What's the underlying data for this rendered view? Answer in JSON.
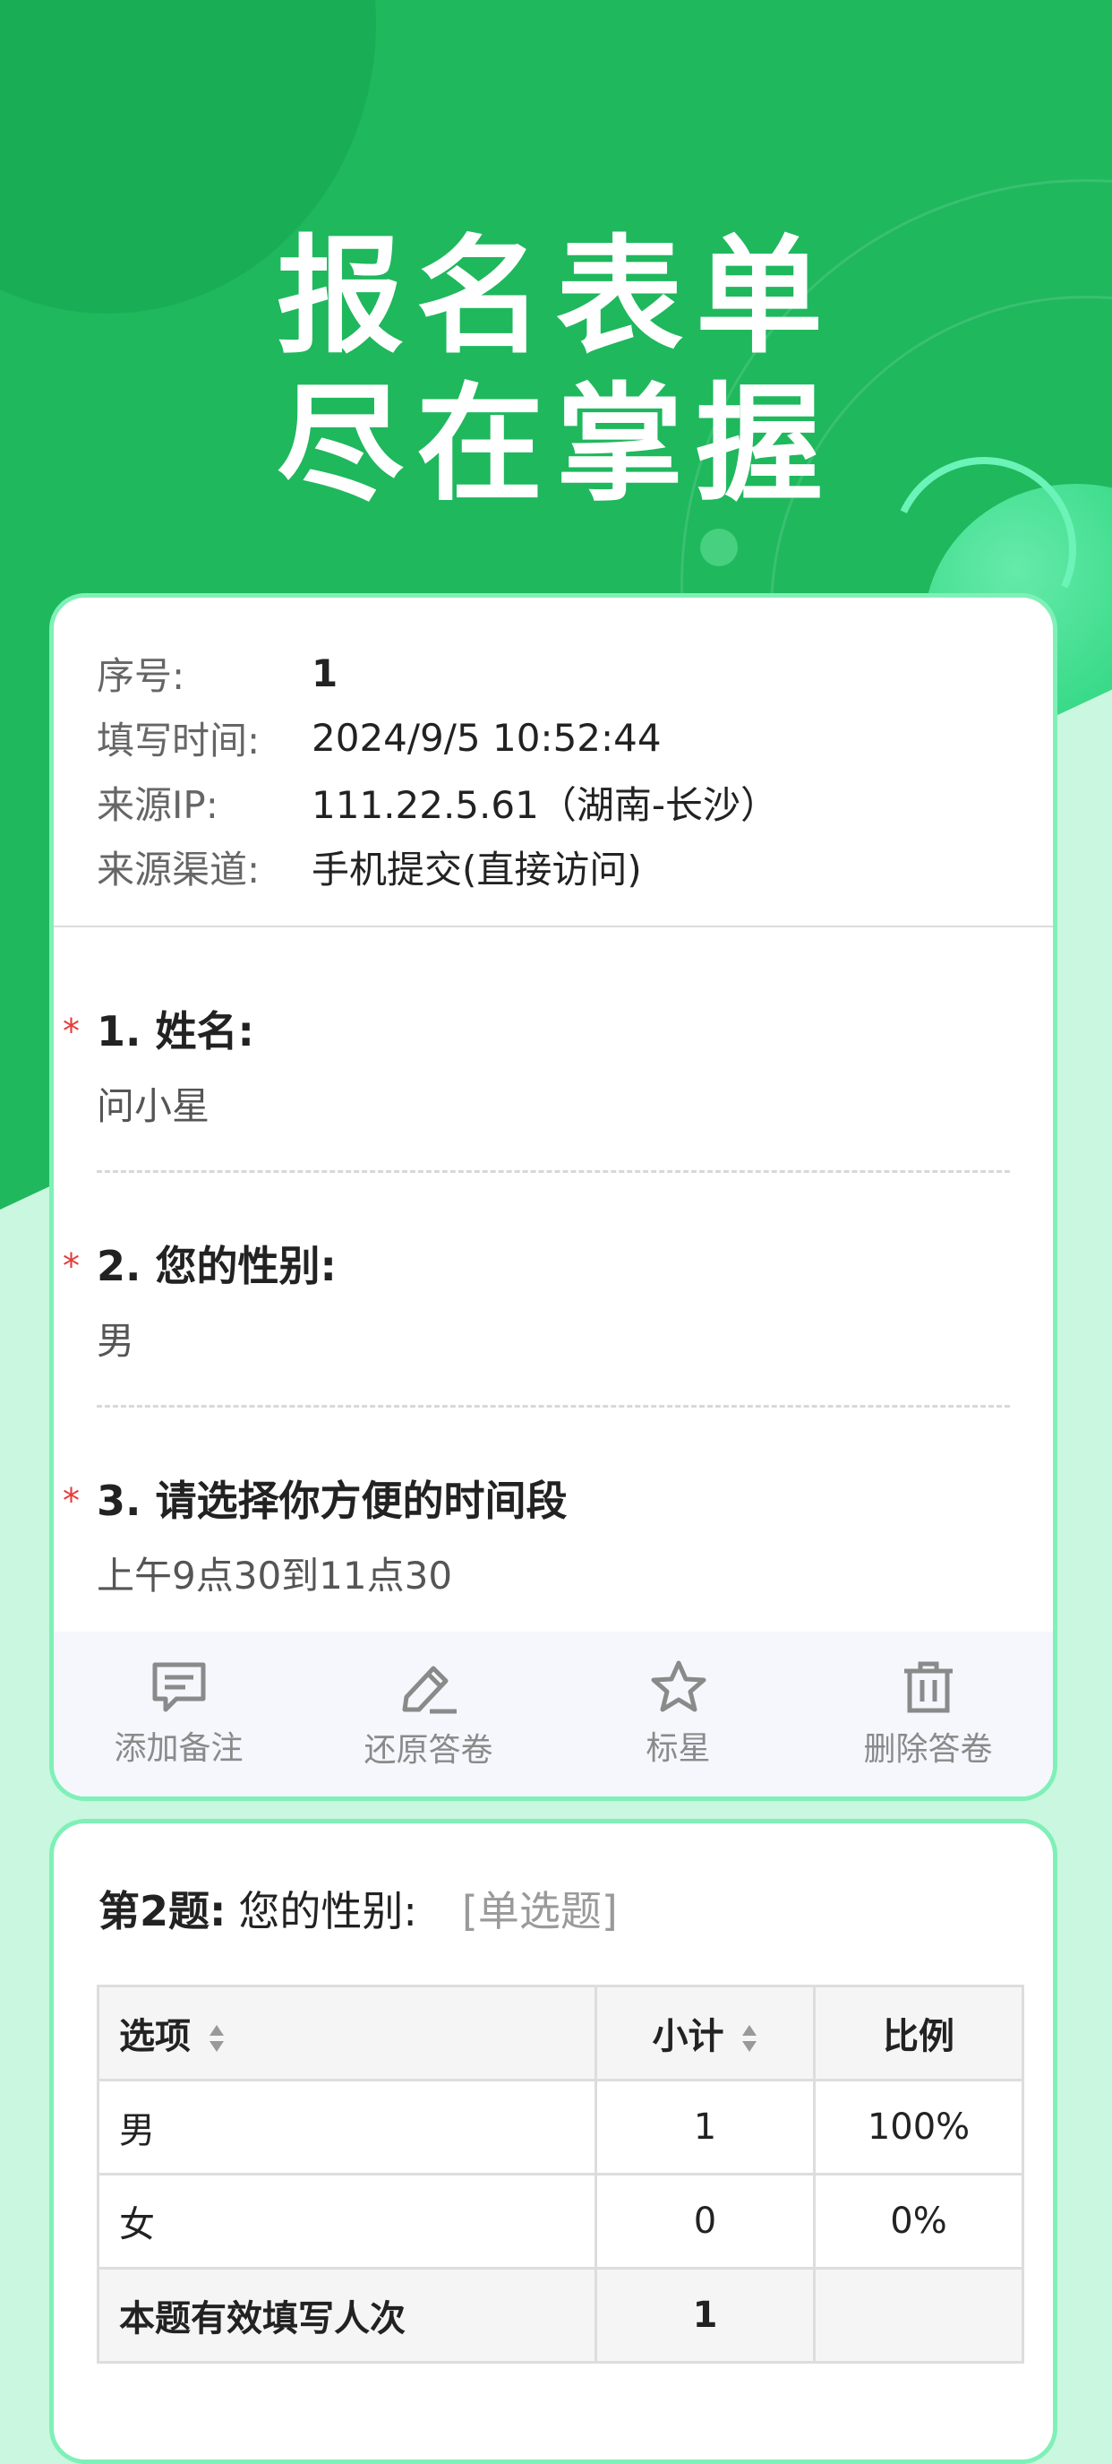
{
  "hero": {
    "line1": "报名表单",
    "line2": "尽在掌握"
  },
  "response": {
    "meta": [
      {
        "label": "序号:",
        "value": "1"
      },
      {
        "label": "填写时间:",
        "value": "2024/9/5 10:52:44"
      },
      {
        "label": "来源IP:",
        "value": "111.22.5.61（湖南-长沙）"
      },
      {
        "label": "来源渠道:",
        "value": "手机提交(直接访问)"
      }
    ],
    "questions": [
      {
        "title": "1. 姓名:",
        "answer": "问小星"
      },
      {
        "title": "2. 您的性别:",
        "answer": "男"
      },
      {
        "title": "3. 请选择你方便的时间段",
        "answer": "上午9点30到11点30"
      }
    ],
    "required_mark": "*",
    "actions": [
      {
        "label": "添加备注",
        "icon": "comment-icon"
      },
      {
        "label": "还原答卷",
        "icon": "edit-pencil-icon"
      },
      {
        "label": "标星",
        "icon": "star-icon"
      },
      {
        "label": "删除答卷",
        "icon": "trash-icon"
      }
    ]
  },
  "stats": {
    "question_num": "第2题:",
    "question_text": "您的性别:",
    "question_type": "[单选题]",
    "headers": {
      "option": "选项",
      "count": "小计",
      "ratio": "比例"
    },
    "rows": [
      {
        "option": "男",
        "count": "1",
        "ratio": "100%"
      },
      {
        "option": "女",
        "count": "0",
        "ratio": "0%"
      }
    ],
    "total": {
      "label": "本题有效填写人次",
      "count": "1",
      "ratio": ""
    }
  },
  "colors": {
    "brand_green": "#1fb85d",
    "card_border": "#7ff0b7",
    "required_red": "#e63b3b"
  }
}
